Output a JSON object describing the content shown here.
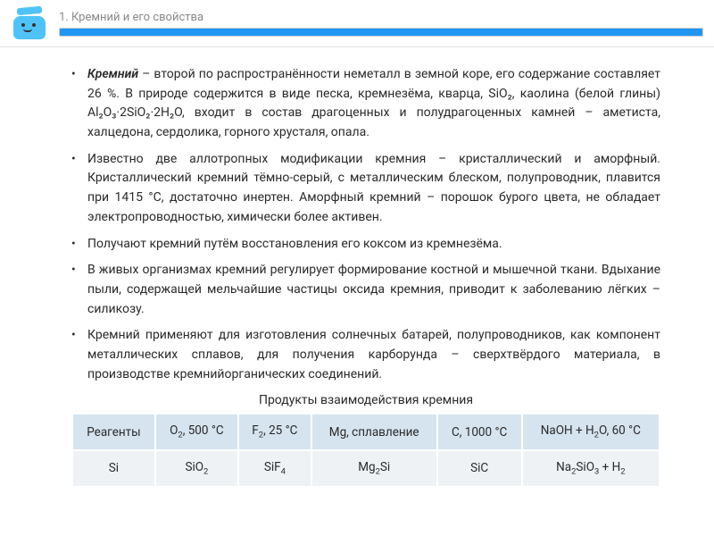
{
  "header": {
    "title": "1. Кремний и его свойства"
  },
  "bullets": [
    {
      "lead": "Кремний",
      "text": " – второй по распространённости неметалл в земной коре, его содержание составляет 26 %. В природе содержится в виде песка, кремнезёма, кварца, SiO₂, каолина (белой глины) Al₂O₃·2SiO₂·2H₂O, входит в состав драгоценных и полудрагоценных камней – аметиста, халцедона, сердолика, горного хрусталя, опала."
    },
    {
      "text": "Известно две аллотропных модификации кремния – кристаллический и аморфный. Кристаллический кремний тёмно-серый, с металлическим блеском, полупроводник, плавится при 1415 °C, достаточно инертен. Аморфный кремний – порошок бурого цвета, не обладает электропроводностью, химически более активен."
    },
    {
      "text": "Получают кремний путём восстановления его коксом из кремнезёма."
    },
    {
      "text": "В живых организмах кремний регулирует формирование костной и мышечной ткани. Вдыхание пыли, содержащей мельчайшие частицы оксида кремния, приводит к заболеванию лёгких – силикозу."
    },
    {
      "text": "Кремний применяют для изготовления солнечных батарей, полупроводников, как компонент металлических сплавов, для получения карборунда – сверхтвёрдого материала, в производстве кремнийорганических соединений."
    }
  ],
  "table": {
    "title": "Продукты взаимодействия кремния",
    "headers": [
      "Реа­генты",
      "O₂, 500 °C",
      "F₂, 25 °C",
      "Mg, сплавление",
      "C, 1000 °C",
      "NaOH + H₂O, 60 °C"
    ],
    "row": [
      "Si",
      "SiO₂",
      "SiF₄",
      "Mg₂Si",
      "SiC",
      "Na₂SiO₃ + H₂"
    ]
  },
  "chart_data": {
    "type": "table",
    "title": "Продукты взаимодействия кремния",
    "categories": [
      "O2, 500 °C",
      "F2, 25 °C",
      "Mg, сплавление",
      "C, 1000 °C",
      "NaOH + H2O, 60 °C"
    ],
    "series": [
      {
        "name": "Si",
        "values": [
          "SiO2",
          "SiF4",
          "Mg2Si",
          "SiC",
          "Na2SiO3 + H2"
        ]
      }
    ]
  }
}
